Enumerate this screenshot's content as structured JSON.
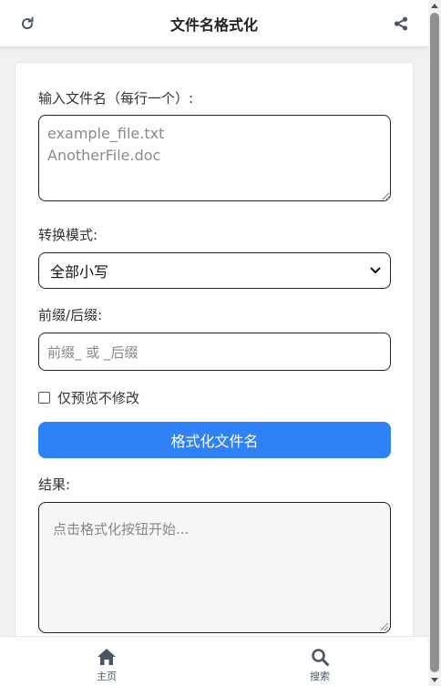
{
  "header": {
    "title": "文件名格式化",
    "refresh_icon": "refresh-icon",
    "share_icon": "share-icon"
  },
  "form": {
    "input_label": "输入文件名（每行一个）:",
    "input_placeholder": "example_file.txt\nAnotherFile.doc",
    "mode_label": "转换模式:",
    "mode_selected": "全部小写",
    "affix_label": "前缀/后缀:",
    "affix_placeholder": "前缀_ 或 _后缀",
    "preview_only_label": "仅预览不修改",
    "preview_only_checked": false,
    "submit_label": "格式化文件名",
    "result_label": "结果:",
    "result_placeholder": "点击格式化按钮开始..."
  },
  "bottom_nav": {
    "home_label": "主页",
    "search_label": "搜索"
  },
  "colors": {
    "primary": "#2f81f7",
    "header_bg": "#ffffff",
    "page_bg": "#f0f1f3",
    "nav_icon": "#4a5568"
  }
}
